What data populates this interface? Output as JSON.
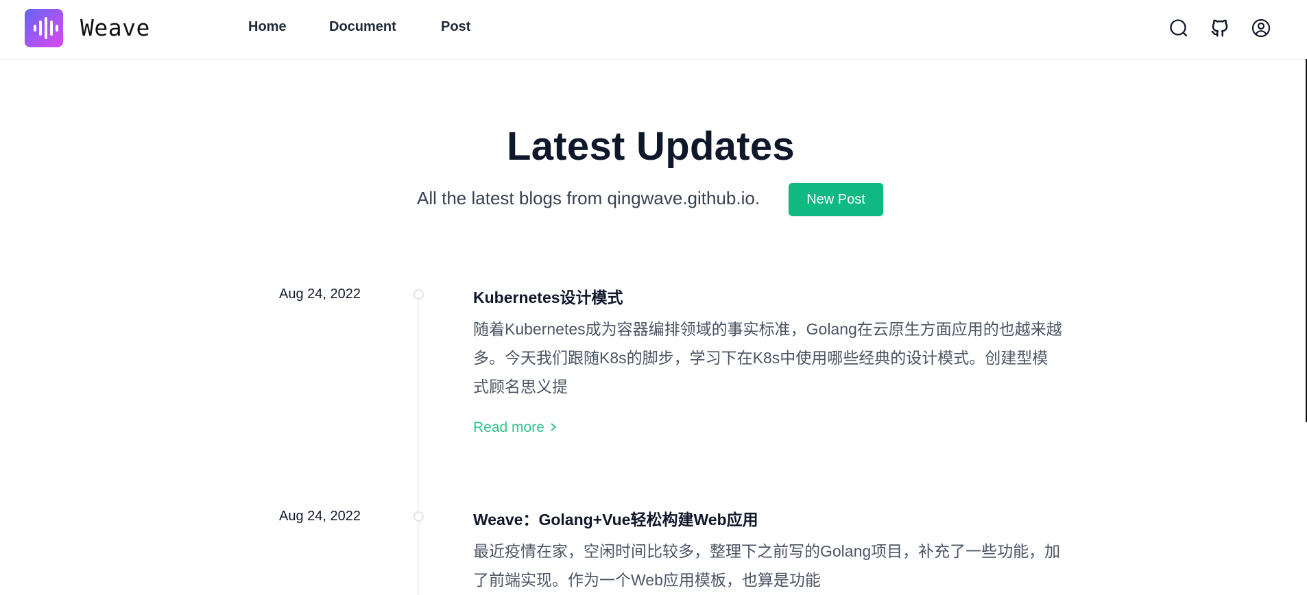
{
  "header": {
    "brand": "Weave",
    "nav": [
      {
        "label": "Home"
      },
      {
        "label": "Document"
      },
      {
        "label": "Post"
      }
    ],
    "icons": [
      "search-icon",
      "github-icon",
      "user-circle-icon"
    ]
  },
  "hero": {
    "title": "Latest Updates",
    "subtitle": "All the latest blogs from qingwave.github.io.",
    "new_post_label": "New Post"
  },
  "posts": [
    {
      "date": "Aug 24, 2022",
      "title": "Kubernetes设计模式",
      "excerpt": "随着Kubernetes成为容器编排领域的事实标准，Golang在云原生方面应用的也越来越多。今天我们跟随K8s的脚步，学习下在K8s中使用哪些经典的设计模式。创建型模式顾名思义提",
      "read_more": "Read more"
    },
    {
      "date": "Aug 24, 2022",
      "title": "Weave：Golang+Vue轻松构建Web应用",
      "excerpt": "最近疫情在家，空闲时间比较多，整理下之前写的Golang项目，补充了一些功能，加了前端实现。作为一个Web应用模板，也算是功能"
    }
  ],
  "colors": {
    "accent": "#10b981",
    "link": "#2ec58b",
    "logo_gradient": [
      "#6366f1",
      "#a855f7",
      "#d946ef"
    ]
  }
}
